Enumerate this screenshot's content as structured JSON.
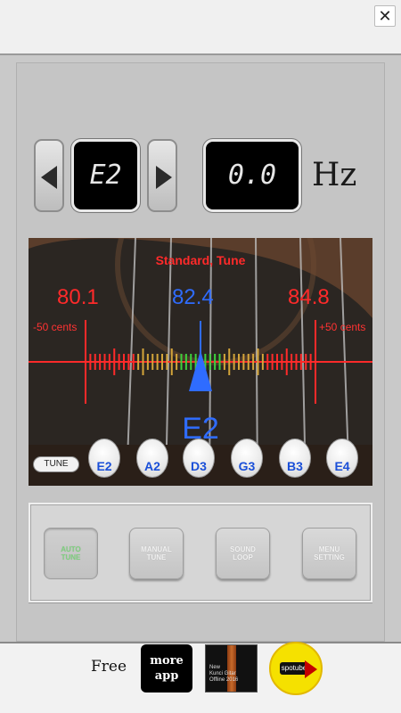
{
  "topbar": {
    "close_icon": "✕"
  },
  "tuner": {
    "current_string": "E2",
    "frequency": "0.0",
    "unit": "Hz"
  },
  "display": {
    "tuning_name": "Standard, Tune",
    "freq_low": "80.1",
    "freq_target": "82.4",
    "freq_high": "84.8",
    "cents_low": "-50 cents",
    "cents_high": "+50 cents",
    "note": "E2",
    "colors": {
      "red": "#ff2a2a",
      "blue": "#2f6cff",
      "green": "#3cd13c",
      "orange": "#d4a53a"
    }
  },
  "strings": {
    "tune_label": "TUNE",
    "items": [
      {
        "label": "E2"
      },
      {
        "label": "A2"
      },
      {
        "label": "D3"
      },
      {
        "label": "G3"
      },
      {
        "label": "B3"
      },
      {
        "label": "E4"
      }
    ]
  },
  "modes": [
    {
      "label": "AUTO\nTUNE",
      "active": true
    },
    {
      "label": "MANUAL\nTUNE",
      "active": false
    },
    {
      "label": "SOUND\nLOOP",
      "active": false
    },
    {
      "label": "MENU\nSETTING",
      "active": false
    }
  ],
  "footer": {
    "free_label": "Free",
    "more_app_line1": "more",
    "more_app_line2": "app",
    "ad_line1": "New",
    "ad_line2": "Kunci Gitar",
    "ad_line3": "Offline 2016",
    "spotube_label": "spotube"
  }
}
